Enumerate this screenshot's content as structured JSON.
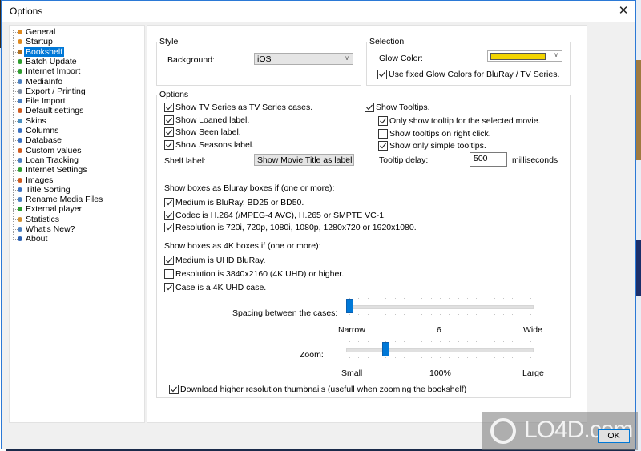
{
  "window": {
    "title": "Options",
    "close_label": "✕"
  },
  "tree": {
    "selected": "Bookshelf",
    "items": [
      {
        "label": "General",
        "icon": "person-icon",
        "color": "#e08a1e"
      },
      {
        "label": "Startup",
        "icon": "person-icon",
        "color": "#e08a1e"
      },
      {
        "label": "Bookshelf",
        "icon": "bookshelf-icon",
        "color": "#b07020"
      },
      {
        "label": "Batch Update",
        "icon": "globe-icon",
        "color": "#2e9e2e"
      },
      {
        "label": "Internet Import",
        "icon": "globe-icon",
        "color": "#2e9e2e"
      },
      {
        "label": "MediaInfo",
        "icon": "info-icon",
        "color": "#4a7fc0"
      },
      {
        "label": "Export / Printing",
        "icon": "export-icon",
        "color": "#7a8aa0"
      },
      {
        "label": "File Import",
        "icon": "file-import-icon",
        "color": "#4a7fc0"
      },
      {
        "label": "Default settings",
        "icon": "person-icon",
        "color": "#d05a1e"
      },
      {
        "label": "Skins",
        "icon": "skins-icon",
        "color": "#4a90c0"
      },
      {
        "label": "Columns",
        "icon": "columns-icon",
        "color": "#3a70c0"
      },
      {
        "label": "Database",
        "icon": "database-icon",
        "color": "#3a70c0"
      },
      {
        "label": "Custom values",
        "icon": "person-icon",
        "color": "#d05a1e"
      },
      {
        "label": "Loan Tracking",
        "icon": "loan-icon",
        "color": "#4a7fc0"
      },
      {
        "label": "Internet Settings",
        "icon": "globe-icon",
        "color": "#2e9e2e"
      },
      {
        "label": "Images",
        "icon": "person-icon",
        "color": "#d05a1e"
      },
      {
        "label": "Title Sorting",
        "icon": "sort-icon",
        "color": "#3a70c0"
      },
      {
        "label": "Rename Media Files",
        "icon": "rename-icon",
        "color": "#4a7fc0"
      },
      {
        "label": "External player",
        "icon": "player-icon",
        "color": "#2e9e2e"
      },
      {
        "label": "Statistics",
        "icon": "statistics-icon",
        "color": "#d09030"
      },
      {
        "label": "What's New?",
        "icon": "whats-new-icon",
        "color": "#4a7fc0"
      },
      {
        "label": "About",
        "icon": "about-icon",
        "color": "#2a5fb0"
      }
    ]
  },
  "style": {
    "group_title": "Style",
    "background_label": "Background:",
    "background_value": "iOS"
  },
  "selection": {
    "group_title": "Selection",
    "glow_color_label": "Glow Color:",
    "glow_color": "#f2d400",
    "fixed_glow": {
      "label": "Use fixed Glow Colors for BluRay / TV Series.",
      "checked": true
    }
  },
  "options": {
    "group_title": "Options",
    "left_checks": [
      {
        "label": "Show TV Series as TV Series cases.",
        "checked": true
      },
      {
        "label": "Show Loaned label.",
        "checked": true
      },
      {
        "label": "Show Seen label.",
        "checked": true
      },
      {
        "label": "Show Seasons label.",
        "checked": true
      }
    ],
    "shelf_label_label": "Shelf label:",
    "shelf_label_value": "Show Movie Title as label",
    "show_tooltips": {
      "label": "Show Tooltips.",
      "checked": true
    },
    "tooltip_checks": [
      {
        "label": "Only show tooltip for the selected movie.",
        "checked": true
      },
      {
        "label": "Show tooltips on right click.",
        "checked": false
      },
      {
        "label": "Show only simple tooltips.",
        "checked": true
      }
    ],
    "tooltip_delay_label": "Tooltip delay:",
    "tooltip_delay_value": "500",
    "tooltip_delay_unit": "milliseconds",
    "bluray_heading": "Show boxes as Bluray boxes if (one or more):",
    "bluray_checks": [
      {
        "label": "Medium is BluRay, BD25 or BD50.",
        "checked": true
      },
      {
        "label": "Codec is H.264 (/MPEG-4 AVC), H.265 or SMPTE VC-1.",
        "checked": true
      },
      {
        "label": "Resolution is 720i, 720p, 1080i, 1080p, 1280x720 or 1920x1080.",
        "checked": true
      }
    ],
    "uhd_heading": "Show boxes as 4K boxes if (one or more):",
    "uhd_checks": [
      {
        "label": "Medium is UHD BluRay.",
        "checked": true
      },
      {
        "label": "Resolution is 3840x2160 (4K UHD) or higher.",
        "checked": false
      },
      {
        "label": "Case is a 4K UHD case.",
        "checked": true
      }
    ],
    "spacing": {
      "label": "Spacing between the cases:",
      "min_label": "Narrow",
      "max_label": "Wide",
      "value_label": "6",
      "fraction": 0.0
    },
    "zoom": {
      "label": "Zoom:",
      "min_label": "Small",
      "max_label": "Large",
      "value_label": "100%",
      "fraction": 0.2
    },
    "download_hires": {
      "label": "Download higher resolution thumbnails (usefull when zooming the bookshelf)",
      "checked": true
    }
  },
  "buttons": {
    "ok": "OK"
  },
  "watermark": {
    "text": "LO4D.com"
  }
}
